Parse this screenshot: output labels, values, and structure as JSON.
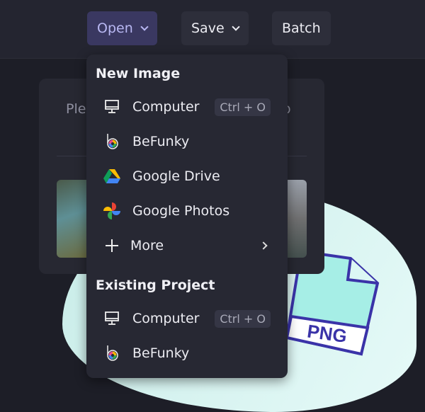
{
  "toolbar": {
    "open_label": "Open",
    "save_label": "Save",
    "batch_label": "Batch"
  },
  "panel": {
    "text_left": "Ple",
    "text_right": "o"
  },
  "illustration": {
    "file_label": "PNG"
  },
  "menu": {
    "new_image_header": "New Image",
    "new_items": [
      {
        "label": "Computer",
        "shortcut": "Ctrl + O",
        "icon": "monitor-icon"
      },
      {
        "label": "BeFunky",
        "icon": "befunky-logo-icon"
      },
      {
        "label": "Google Drive",
        "icon": "google-drive-icon"
      },
      {
        "label": "Google Photos",
        "icon": "google-photos-icon"
      },
      {
        "label": "More",
        "icon": "plus-icon"
      }
    ],
    "existing_header": "Existing Project",
    "existing_items": [
      {
        "label": "Computer",
        "shortcut": "Ctrl + O",
        "icon": "monitor-icon"
      },
      {
        "label": "BeFunky",
        "icon": "befunky-logo-icon"
      }
    ]
  },
  "colors": {
    "accent": "#3a3861",
    "accent_text": "#b9b8f3",
    "png_stroke": "#3a33a8"
  }
}
